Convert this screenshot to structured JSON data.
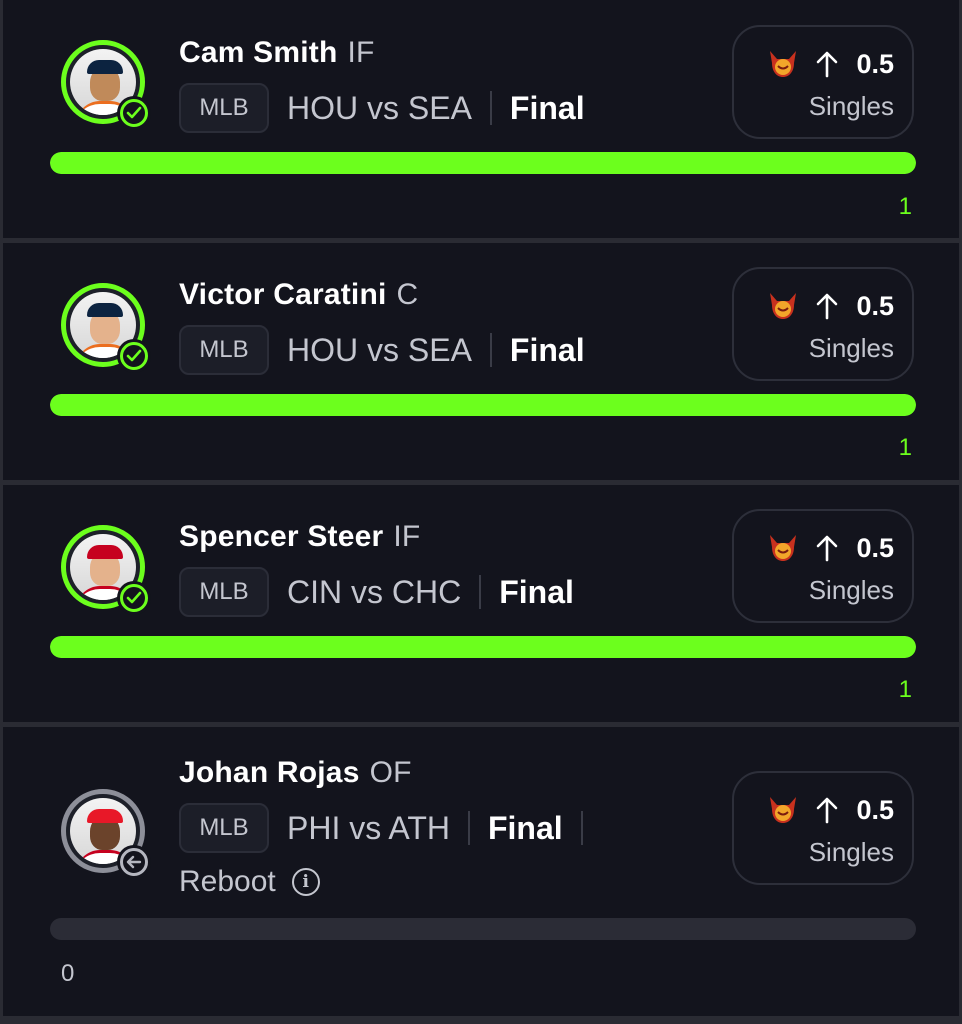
{
  "colors": {
    "accent_green": "#6cff1d",
    "card_bg": "#13141d",
    "divider": "#2a2b33",
    "muted_text": "#c4c6cf"
  },
  "picks": [
    {
      "player_name": "Cam Smith",
      "position": "IF",
      "league": "MLB",
      "matchup": "HOU vs SEA",
      "game_status": "Final",
      "direction": "up-arrow-icon",
      "line": "0.5",
      "stat": "Singles",
      "result": "1",
      "progress": 1.0,
      "status_icon": "check-icon"
    },
    {
      "player_name": "Victor Caratini",
      "position": "C",
      "league": "MLB",
      "matchup": "HOU vs SEA",
      "game_status": "Final",
      "direction": "up-arrow-icon",
      "line": "0.5",
      "stat": "Singles",
      "result": "1",
      "progress": 1.0,
      "status_icon": "check-icon"
    },
    {
      "player_name": "Spencer Steer",
      "position": "IF",
      "league": "MLB",
      "matchup": "CIN vs CHC",
      "game_status": "Final",
      "direction": "up-arrow-icon",
      "line": "0.5",
      "stat": "Singles",
      "result": "1",
      "progress": 1.0,
      "status_icon": "check-icon"
    },
    {
      "player_name": "Johan Rojas",
      "position": "OF",
      "league": "MLB",
      "matchup": "PHI vs ATH",
      "game_status": "Final",
      "note": "Reboot",
      "direction": "up-arrow-icon",
      "line": "0.5",
      "stat": "Singles",
      "result": "0",
      "progress": 0.0,
      "status_icon": "reboot-icon"
    }
  ]
}
